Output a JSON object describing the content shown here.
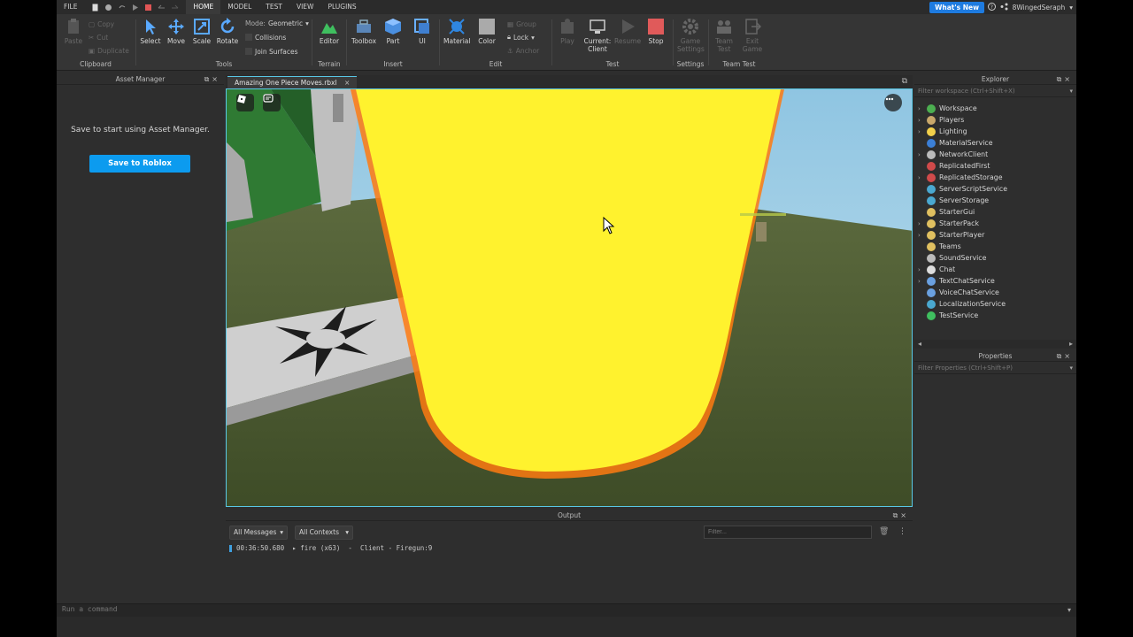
{
  "menubar": {
    "items": [
      "FILE",
      "HOME",
      "MODEL",
      "TEST",
      "VIEW",
      "PLUGINS"
    ],
    "active": "HOME",
    "whats_new": "What's New",
    "username": "8WingedSeraph"
  },
  "ribbon": {
    "clipboard": {
      "label": "Clipboard",
      "paste": "Paste",
      "copy": "Copy",
      "cut": "Cut",
      "duplicate": "Duplicate"
    },
    "tools": {
      "label": "Tools",
      "select": "Select",
      "move": "Move",
      "scale": "Scale",
      "rotate": "Rotate",
      "mode_label": "Mode:",
      "mode_value": "Geometric",
      "collisions": "Collisions",
      "join_surfaces": "Join Surfaces"
    },
    "terrain": {
      "label": "Terrain",
      "editor": "Editor"
    },
    "insert": {
      "label": "Insert",
      "toolbox": "Toolbox",
      "part": "Part",
      "ui": "UI"
    },
    "edit": {
      "label": "Edit",
      "material": "Material",
      "color": "Color",
      "group": "Group",
      "lock": "Lock",
      "anchor": "Anchor"
    },
    "test": {
      "label": "Test",
      "play": "Play",
      "current_client_1": "Current:",
      "current_client_2": "Client",
      "resume": "Resume",
      "stop": "Stop"
    },
    "settings": {
      "label": "Settings",
      "game_settings_1": "Game",
      "game_settings_2": "Settings"
    },
    "team_test": {
      "label": "Team Test",
      "team_test_1": "Team",
      "team_test_2": "Test",
      "exit_game_1": "Exit",
      "exit_game_2": "Game"
    }
  },
  "asset_manager": {
    "title": "Asset Manager",
    "message": "Save to start using Asset Manager.",
    "button": "Save to Roblox"
  },
  "document": {
    "tab_name": "Amazing One Piece Moves.rbxl"
  },
  "output": {
    "title": "Output",
    "messages_filter": "All Messages",
    "contexts_filter": "All Contexts",
    "filter_placeholder": "Filter...",
    "log": "00:36:50.680  ▸ fire (x63)  -  Client - Firegun:9"
  },
  "explorer": {
    "title": "Explorer",
    "filter_placeholder": "Filter workspace (Ctrl+Shift+X)",
    "items": [
      {
        "name": "Workspace",
        "expandable": true,
        "color": "#4caf50"
      },
      {
        "name": "Players",
        "expandable": true,
        "color": "#c9a86b"
      },
      {
        "name": "Lighting",
        "expandable": true,
        "color": "#f2d04a"
      },
      {
        "name": "MaterialService",
        "expandable": false,
        "color": "#3b7fd6"
      },
      {
        "name": "NetworkClient",
        "expandable": true,
        "color": "#bbbbbb"
      },
      {
        "name": "ReplicatedFirst",
        "expandable": false,
        "color": "#d04a4a"
      },
      {
        "name": "ReplicatedStorage",
        "expandable": true,
        "color": "#d04a4a"
      },
      {
        "name": "ServerScriptService",
        "expandable": false,
        "color": "#4aa8d0"
      },
      {
        "name": "ServerStorage",
        "expandable": false,
        "color": "#4aa8d0"
      },
      {
        "name": "StarterGui",
        "expandable": false,
        "color": "#e0c060"
      },
      {
        "name": "StarterPack",
        "expandable": true,
        "color": "#e0c060"
      },
      {
        "name": "StarterPlayer",
        "expandable": true,
        "color": "#e0c060"
      },
      {
        "name": "Teams",
        "expandable": false,
        "color": "#e0c060"
      },
      {
        "name": "SoundService",
        "expandable": false,
        "color": "#bbbbbb"
      },
      {
        "name": "Chat",
        "expandable": true,
        "color": "#dddddd"
      },
      {
        "name": "TextChatService",
        "expandable": true,
        "color": "#6aa0e0"
      },
      {
        "name": "VoiceChatService",
        "expandable": false,
        "color": "#6aa0e0"
      },
      {
        "name": "LocalizationService",
        "expandable": false,
        "color": "#4aa8d0"
      },
      {
        "name": "TestService",
        "expandable": false,
        "color": "#3fbf5f"
      }
    ]
  },
  "properties": {
    "title": "Properties",
    "filter_placeholder": "Filter Properties (Ctrl+Shift+P)"
  },
  "command_bar": {
    "placeholder": "Run a command"
  },
  "colors": {
    "accent": "#0c9bef",
    "viewport_border": "#59c8e6",
    "beam_yellow": "#fff22e"
  }
}
